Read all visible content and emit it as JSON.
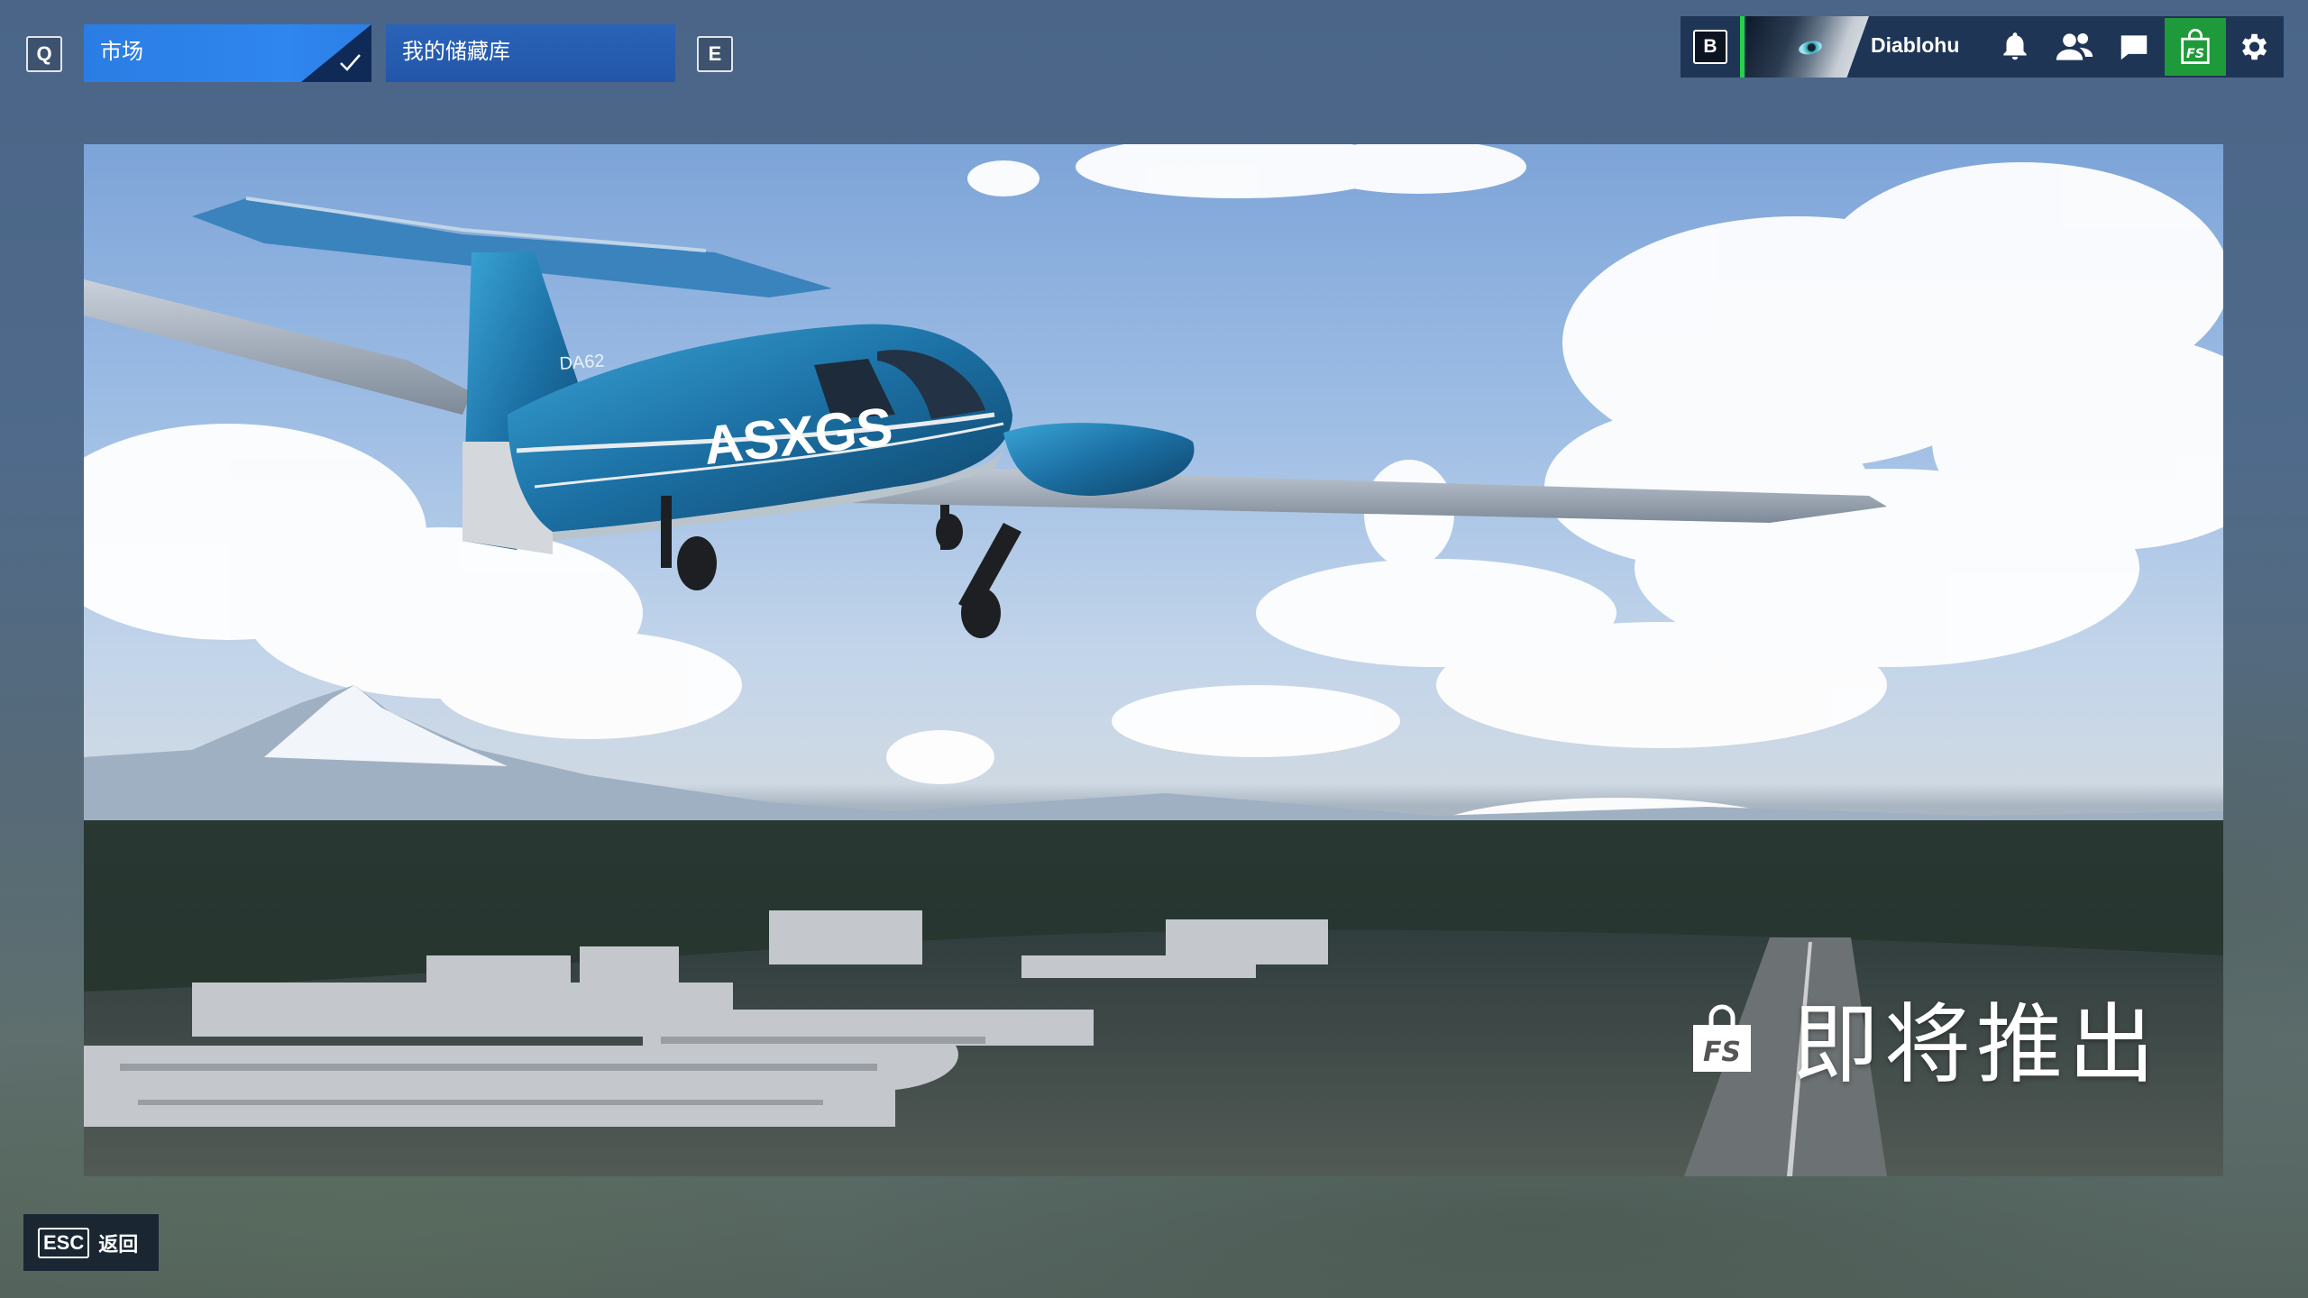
{
  "topbar": {
    "left_key": "Q",
    "right_key": "E",
    "tabs": [
      {
        "label": "市场",
        "selected": true
      },
      {
        "label": "我的储藏库",
        "selected": false
      }
    ]
  },
  "profile": {
    "key": "B",
    "username": "Diablohu",
    "online_color": "#27d14a",
    "icons": [
      "bell-icon",
      "friends-icon",
      "chat-icon",
      "marketplace-icon",
      "gear-icon"
    ]
  },
  "hero": {
    "plane_registration": "ASXGS",
    "plane_model": "DA62",
    "coming_soon": "即将推出"
  },
  "footer": {
    "back_key": "ESC",
    "back_label": "返回"
  },
  "colors": {
    "tab_selected": "#2f86ee",
    "tab_default": "#2356a8",
    "marketplace_green": "#1f9a3a"
  }
}
